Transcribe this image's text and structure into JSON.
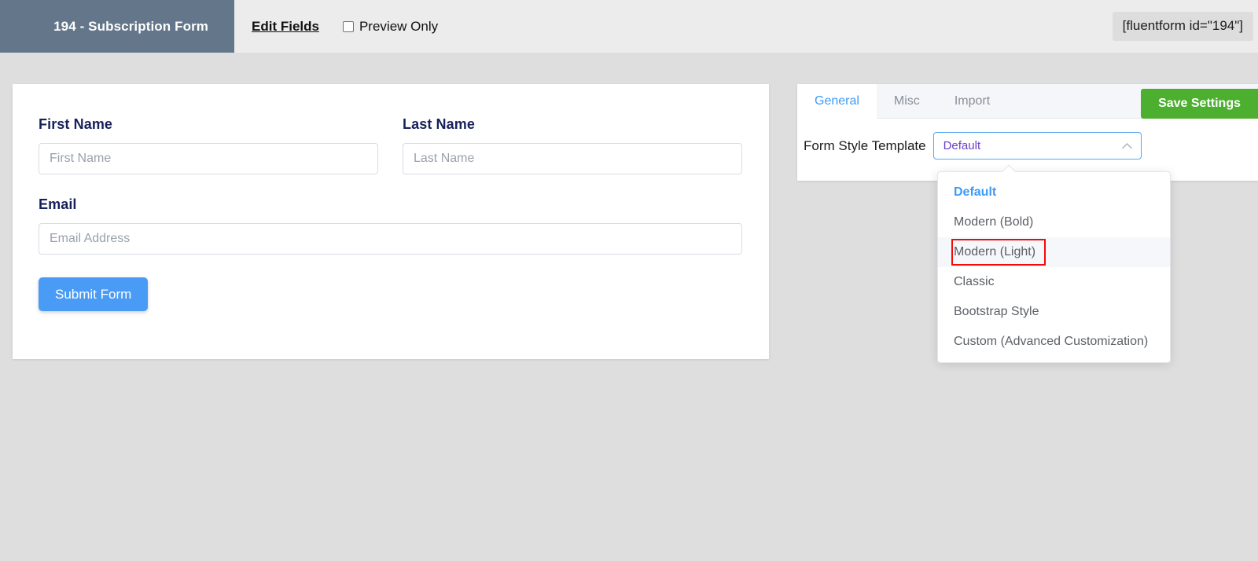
{
  "topbar": {
    "form_title": "194 - Subscription Form",
    "edit_fields_label": "Edit Fields",
    "preview_only_label": "Preview Only",
    "preview_only_checked": false,
    "shortcode": "[fluentform id=\"194\"]",
    "title_bg_color": "#64768a",
    "bar_bg_color": "#ececec"
  },
  "form_preview": {
    "fields": [
      {
        "label": "First Name",
        "placeholder": "First Name",
        "value": ""
      },
      {
        "label": "Last Name",
        "placeholder": "Last Name",
        "value": ""
      },
      {
        "label": "Email",
        "placeholder": "Email Address",
        "value": ""
      }
    ],
    "submit_label": "Submit Form",
    "label_color": "#16215b",
    "submit_color": "#4a9bf5"
  },
  "settings": {
    "tabs": [
      {
        "label": "General",
        "active": true
      },
      {
        "label": "Misc",
        "active": false
      },
      {
        "label": "Import",
        "active": false
      }
    ],
    "save_label": "Save Settings",
    "save_color": "#4caf30",
    "style_template": {
      "label": "Form Style Template",
      "selected_value": "Default",
      "caret_icon": "chevron-up-icon",
      "options": [
        {
          "label": "Default",
          "selected": true,
          "hovered": false
        },
        {
          "label": "Modern (Bold)",
          "selected": false,
          "hovered": false
        },
        {
          "label": "Modern (Light)",
          "selected": false,
          "hovered": true
        },
        {
          "label": "Classic",
          "selected": false,
          "hovered": false
        },
        {
          "label": "Bootstrap Style",
          "selected": false,
          "hovered": false
        },
        {
          "label": "Custom (Advanced Customization)",
          "selected": false,
          "hovered": false
        }
      ]
    }
  },
  "annotation": {
    "highlight_target": "Modern (Light)",
    "color": "#f30a0a"
  }
}
